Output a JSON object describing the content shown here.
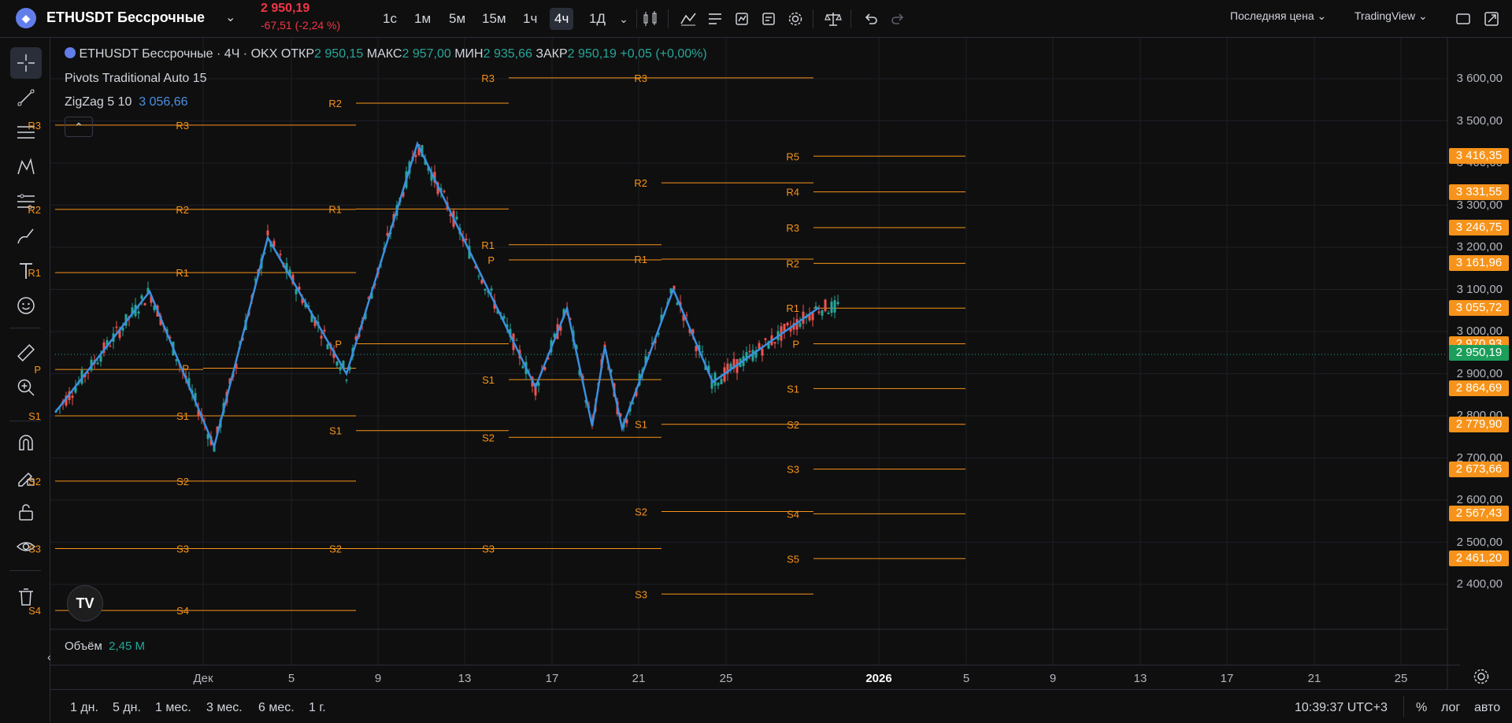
{
  "header": {
    "symbol_logo": "eth-logo",
    "symbol": "ETHUSDT Бессрочные",
    "last_price": "2 950,19",
    "change": "-67,51 (-2,24 %)",
    "timeframes": [
      "1с",
      "1м",
      "5м",
      "15м",
      "1ч",
      "4ч",
      "1Д"
    ],
    "active_timeframe": "4ч",
    "price_type": "Последняя цена",
    "broker": "TradingView"
  },
  "legend": {
    "title": "ETHUSDT Бессрочные · 4Ч · OKX",
    "open_label": "ОТКР",
    "open": "2 950,15",
    "high_label": "МАКС",
    "high": "2 957,00",
    "low_label": "МИН",
    "low": "2 935,66",
    "close_label": "ЗАКР",
    "close": "2 950,19",
    "change": "+0,05 (+0,00%)",
    "indicator1": "Pivots Traditional Auto 15",
    "indicator2_name": "ZigZag 5 10",
    "indicator2_value": "3 056,66"
  },
  "volume": {
    "label": "Объём",
    "value": "2,45 M"
  },
  "yaxis": [
    "3 600,00",
    "3 500,00",
    "3 400,00",
    "3 300,00",
    "3 200,00",
    "3 100,00",
    "3 000,00",
    "2 900,00",
    "2 800,00",
    "2 700,00",
    "2 600,00",
    "2 500,00",
    "2 400,00"
  ],
  "price_tags": [
    {
      "text": "3 416,35",
      "color": "#f7931a",
      "price": 3416.35
    },
    {
      "text": "3 331,55",
      "color": "#f7931a",
      "price": 3331.55
    },
    {
      "text": "3 246,75",
      "color": "#f7931a",
      "price": 3246.75
    },
    {
      "text": "3 161,96",
      "color": "#f7931a",
      "price": 3161.96
    },
    {
      "text": "3 055,72",
      "color": "#f7931a",
      "price": 3055.72
    },
    {
      "text": "2 970,93",
      "color": "#f7931a",
      "price": 2970.93
    },
    {
      "text": "2 950,19",
      "color": "#1b9e5a",
      "price": 2950.19
    },
    {
      "text": "2 864,69",
      "color": "#f7931a",
      "price": 2864.69
    },
    {
      "text": "2 779,90",
      "color": "#f7931a",
      "price": 2779.9
    },
    {
      "text": "2 673,66",
      "color": "#f7931a",
      "price": 2673.66
    },
    {
      "text": "2 567,43",
      "color": "#f7931a",
      "price": 2567.43
    },
    {
      "text": "2 461,20",
      "color": "#f7931a",
      "price": 2461.2
    }
  ],
  "xaxis": [
    {
      "t": "Дек",
      "bold": false
    },
    {
      "t": "5",
      "bold": false
    },
    {
      "t": "9",
      "bold": false
    },
    {
      "t": "13",
      "bold": false
    },
    {
      "t": "17",
      "bold": false
    },
    {
      "t": "21",
      "bold": false
    },
    {
      "t": "25",
      "bold": false
    },
    {
      "t": "2026",
      "bold": true
    },
    {
      "t": "5",
      "bold": false
    },
    {
      "t": "9",
      "bold": false
    },
    {
      "t": "13",
      "bold": false
    },
    {
      "t": "17",
      "bold": false
    },
    {
      "t": "21",
      "bold": false
    },
    {
      "t": "25",
      "bold": false
    }
  ],
  "bottom": {
    "ranges": [
      "1 дн.",
      "5 дн.",
      "1 мес.",
      "3 мес.",
      "6 мес.",
      "1 г."
    ],
    "clock": "10:39:37 UTC+3",
    "percent": "%",
    "log": "лог",
    "auto": "авто"
  },
  "chart_data": {
    "type": "candlestick",
    "pivot_levels": [
      {
        "label": "R3",
        "price": 3490
      },
      {
        "label": "R2",
        "price": 3290
      },
      {
        "label": "R1",
        "price": 3140
      },
      {
        "label": "P",
        "price": 2910
      },
      {
        "label": "S1",
        "price": 2800
      },
      {
        "label": "S2",
        "price": 2645
      },
      {
        "label": "S3",
        "price": 2485
      },
      {
        "label": "S4",
        "price": 2338
      },
      {
        "label": "R2",
        "price": 3542
      },
      {
        "label": "R1",
        "price": 3291
      },
      {
        "label": "P",
        "price": 2971
      },
      {
        "label": "S1",
        "price": 2765
      },
      {
        "label": "S2",
        "price": 2485
      },
      {
        "label": "R3",
        "price": 3602
      },
      {
        "label": "R2",
        "price": 3542
      },
      {
        "label": "R1",
        "price": 3206
      },
      {
        "label": "P",
        "price": 3170
      },
      {
        "label": "S1",
        "price": 2886
      },
      {
        "label": "S2",
        "price": 2749
      },
      {
        "label": "S3",
        "price": 2485
      },
      {
        "label": "R3",
        "price": 3602
      },
      {
        "label": "R2",
        "price": 3353
      },
      {
        "label": "R1",
        "price": 3172
      },
      {
        "label": "S1",
        "price": 2780
      },
      {
        "label": "S2",
        "price": 2573
      },
      {
        "label": "S3",
        "price": 2377
      },
      {
        "label": "R5",
        "price": 3416.35
      },
      {
        "label": "R4",
        "price": 3331.55
      },
      {
        "label": "R3",
        "price": 3246.75
      },
      {
        "label": "R2",
        "price": 3161.96
      },
      {
        "label": "R1",
        "price": 3055.72
      },
      {
        "label": "P",
        "price": 2970.93
      },
      {
        "label": "S1",
        "price": 2864.69
      },
      {
        "label": "S2",
        "price": 2779.9
      },
      {
        "label": "S3",
        "price": 2673.66
      },
      {
        "label": "S4",
        "price": 2567.43
      },
      {
        "label": "S5",
        "price": 2461.2
      }
    ],
    "zigzag": [
      2808,
      3095,
      2727,
      3223,
      2900,
      3446,
      2868,
      3055,
      2776,
      2964,
      2770,
      3100,
      2880,
      3057
    ],
    "current_price": 2950.19,
    "ylim": [
      2340,
      3640
    ]
  }
}
